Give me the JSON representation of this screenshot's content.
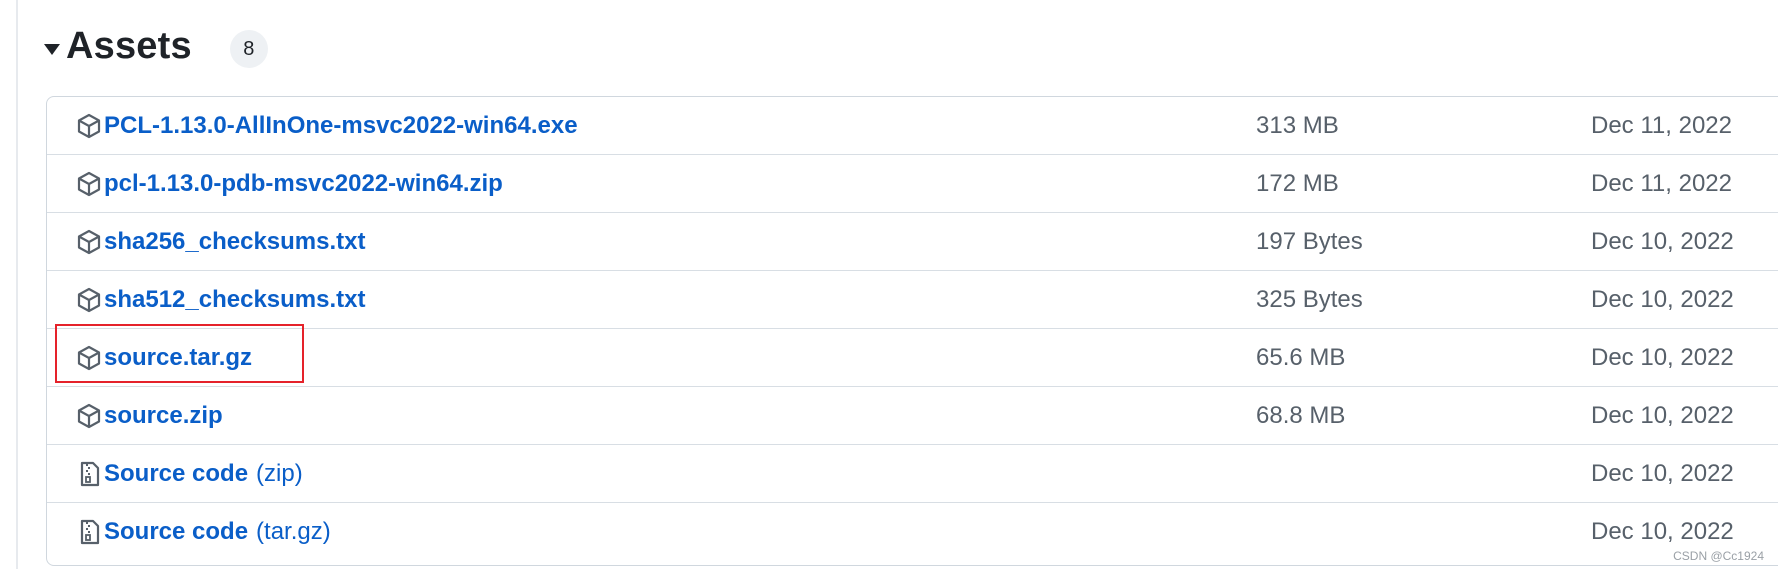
{
  "assets": {
    "title": "Assets",
    "count": "8",
    "rows": [
      {
        "icon": "package-icon",
        "name": "PCL-1.13.0-AllInOne-msvc2022-win64.exe",
        "suffix": "",
        "size": "313 MB",
        "date": "Dec 11, 2022"
      },
      {
        "icon": "package-icon",
        "name": "pcl-1.13.0-pdb-msvc2022-win64.zip",
        "suffix": "",
        "size": "172 MB",
        "date": "Dec 11, 2022"
      },
      {
        "icon": "package-icon",
        "name": "sha256_checksums.txt",
        "suffix": "",
        "size": "197 Bytes",
        "date": "Dec 10, 2022"
      },
      {
        "icon": "package-icon",
        "name": "sha512_checksums.txt",
        "suffix": "",
        "size": "325 Bytes",
        "date": "Dec 10, 2022"
      },
      {
        "icon": "package-icon",
        "name": "source.tar.gz",
        "suffix": "",
        "size": "65.6 MB",
        "date": "Dec 10, 2022"
      },
      {
        "icon": "package-icon",
        "name": "source.zip",
        "suffix": "",
        "size": "68.8 MB",
        "date": "Dec 10, 2022"
      },
      {
        "icon": "file-zip-icon",
        "name": "Source code",
        "suffix": "(zip)",
        "size": "",
        "date": "Dec 10, 2022"
      },
      {
        "icon": "file-zip-icon",
        "name": "Source code",
        "suffix": "(tar.gz)",
        "size": "",
        "date": "Dec 10, 2022"
      }
    ]
  },
  "watermark": "CSDN @Cc1924",
  "colors": {
    "link": "#0a5ec8",
    "muted": "#57606a",
    "highlight": "#e5222a"
  }
}
